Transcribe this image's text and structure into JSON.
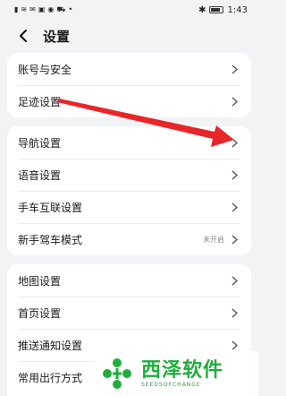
{
  "status_bar": {
    "left_icons": [
      "signal-icon",
      "wifi-icon",
      "mail-icon",
      "photo-icon",
      "notification-icon",
      "car-icon",
      "more-dots-icon"
    ],
    "time": "1:43"
  },
  "header": {
    "title": "设置"
  },
  "sections": [
    {
      "items": [
        {
          "label": "账号与安全"
        },
        {
          "label": "足迹设置"
        }
      ]
    },
    {
      "items": [
        {
          "label": "导航设置"
        },
        {
          "label": "语音设置"
        },
        {
          "label": "手车互联设置"
        },
        {
          "label": "新手驾车模式",
          "value": "未开启"
        }
      ]
    },
    {
      "items": [
        {
          "label": "地图设置"
        },
        {
          "label": "首页设置"
        },
        {
          "label": "推送通知设置"
        },
        {
          "label": "常用出行方式"
        }
      ]
    }
  ],
  "annotation": {
    "color": "#e8262a"
  },
  "watermark": {
    "name": "西泽软件",
    "sub": "SEEDSOFCHANGE",
    "color": "#1fae3d"
  }
}
